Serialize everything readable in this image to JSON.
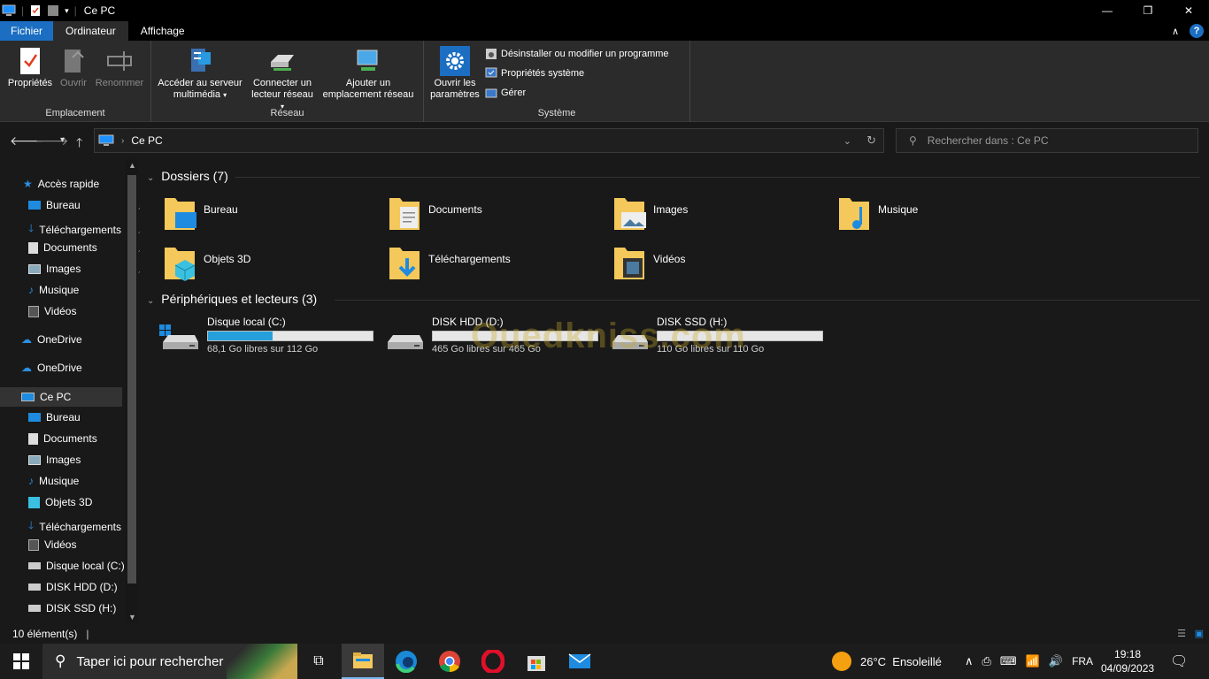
{
  "window": {
    "title": "Ce PC"
  },
  "menu": {
    "tabs": [
      "Fichier",
      "Ordinateur",
      "Affichage"
    ]
  },
  "ribbon": {
    "emplacement": {
      "label": "Emplacement",
      "buttons": [
        "Propriétés",
        "Ouvrir",
        "Renommer"
      ]
    },
    "reseau": {
      "label": "Réseau",
      "media_line1": "Accéder au serveur",
      "media_line2": "multimédia",
      "drive_line1": "Connecter un",
      "drive_line2": "lecteur réseau",
      "loc_line1": "Ajouter un",
      "loc_line2": "emplacement réseau"
    },
    "systeme": {
      "label": "Système",
      "settings_line1": "Ouvrir les",
      "settings_line2": "paramètres",
      "small": [
        "Désinstaller ou modifier un programme",
        "Propriétés système",
        "Gérer"
      ]
    }
  },
  "address": {
    "path": "Ce PC",
    "search_placeholder": "Rechercher dans : Ce PC"
  },
  "sidebar": {
    "quick_access": "Accès rapide",
    "quick_items": [
      "Bureau",
      "Téléchargements",
      "Documents",
      "Images",
      "Musique",
      "Vidéos"
    ],
    "onedrive1": "OneDrive",
    "onedrive2": "OneDrive",
    "this_pc": "Ce PC",
    "pc_items": [
      "Bureau",
      "Documents",
      "Images",
      "Musique",
      "Objets 3D",
      "Téléchargements",
      "Vidéos",
      "Disque local (C:)",
      "DISK HDD (D:)",
      "DISK SSD (H:)"
    ]
  },
  "content": {
    "folders_header": "Dossiers (7)",
    "folders": [
      "Bureau",
      "Documents",
      "Images",
      "Musique",
      "Objets 3D",
      "Téléchargements",
      "Vidéos"
    ],
    "drives_header": "Périphériques et lecteurs (3)",
    "drives": [
      {
        "name": "Disque local (C:)",
        "free": "68,1 Go libres sur 112 Go",
        "used_fraction": 0.39
      },
      {
        "name": "DISK HDD (D:)",
        "free": "465 Go libres sur 465 Go",
        "used_fraction": 0.0
      },
      {
        "name": "DISK SSD (H:)",
        "free": "110 Go libres sur 110 Go",
        "used_fraction": 0.0
      }
    ],
    "watermark": "Ouedkniss.com"
  },
  "status": {
    "count": "10 élément(s)"
  },
  "taskbar": {
    "search_placeholder": "Taper ici pour rechercher",
    "weather": "26°C  Ensoleillé",
    "lang": "FRA",
    "time": "19:18",
    "date": "04/09/2023"
  },
  "colors": {
    "accent": "#1b6ec2",
    "folder": "#f4c85a",
    "drive_bar": "#26a0da"
  }
}
